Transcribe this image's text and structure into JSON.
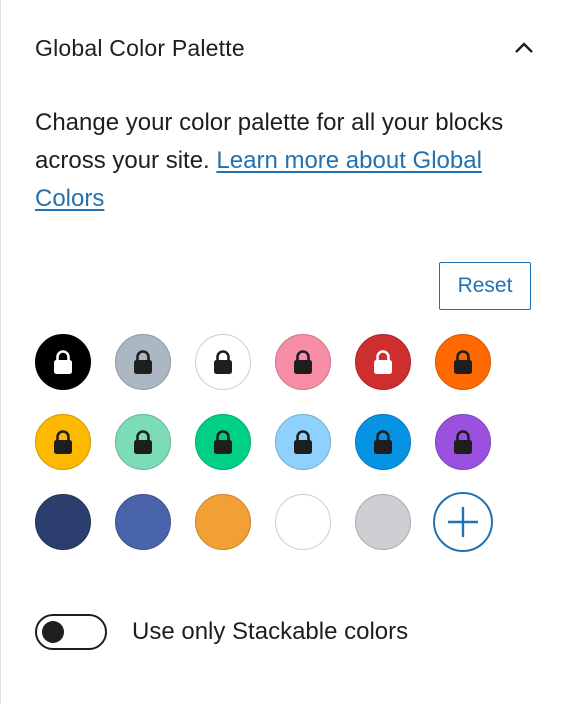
{
  "panel": {
    "title": "Global Color Palette",
    "description": "Change your color palette for all your blocks across your site. ",
    "link_text": "Learn more about Global Colors",
    "reset_label": "Reset",
    "toggle_label": "Use only Stackable colors",
    "toggle_on": false
  },
  "palette": [
    {
      "color": "#000000",
      "locked": true,
      "lock_color": "#ffffff"
    },
    {
      "color": "#abb8c3",
      "locked": true,
      "lock_color": "#1e1e1e"
    },
    {
      "color": "#ffffff",
      "locked": true,
      "lock_color": "#1e1e1e"
    },
    {
      "color": "#f78da7",
      "locked": true,
      "lock_color": "#1e1e1e"
    },
    {
      "color": "#cf2e2e",
      "locked": true,
      "lock_color": "#ffffff"
    },
    {
      "color": "#ff6900",
      "locked": true,
      "lock_color": "#1e1e1e"
    },
    {
      "color": "#fcb900",
      "locked": true,
      "lock_color": "#1e1e1e"
    },
    {
      "color": "#7bdcb5",
      "locked": true,
      "lock_color": "#1e1e1e"
    },
    {
      "color": "#00d084",
      "locked": true,
      "lock_color": "#1e1e1e"
    },
    {
      "color": "#8ed1fc",
      "locked": true,
      "lock_color": "#1e1e1e"
    },
    {
      "color": "#0693e3",
      "locked": true,
      "lock_color": "#1e1e1e"
    },
    {
      "color": "#9b51e0",
      "locked": true,
      "lock_color": "#1e1e1e"
    },
    {
      "color": "#2c3e6e",
      "locked": false
    },
    {
      "color": "#4a64ab",
      "locked": false
    },
    {
      "color": "#f2a036",
      "locked": false
    },
    {
      "color": "#ffffff",
      "locked": false
    },
    {
      "color": "#cdcfd2",
      "locked": false
    }
  ],
  "colors": {
    "accent": "#2271b1",
    "text": "#1e1e1e"
  }
}
